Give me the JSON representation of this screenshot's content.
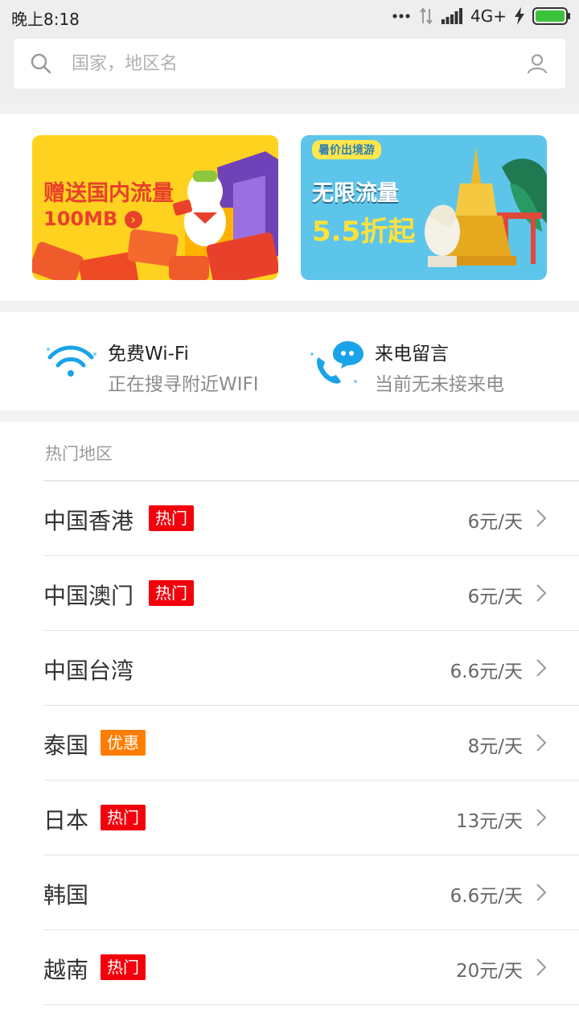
{
  "status_bar": {
    "time": "晚上8:18",
    "network": "4G+",
    "icons": [
      "dots-icon",
      "data-arrows-icon",
      "signal-icon",
      "charging-icon",
      "battery-icon"
    ]
  },
  "search": {
    "placeholder": "国家，地区名",
    "value": ""
  },
  "banners": [
    {
      "title": "赠送国内流量",
      "subtitle": "100MB"
    },
    {
      "tag": "暑价出境游",
      "title": "无限流量",
      "subtitle": "5.5折起"
    }
  ],
  "services": [
    {
      "title": "免费Wi-Fi",
      "subtitle": "正在搜寻附近WIFI",
      "icon": "wifi-icon"
    },
    {
      "title": "来电留言",
      "subtitle": "当前无未接来电",
      "icon": "voicemail-icon"
    }
  ],
  "hot_regions": {
    "title": "热门地区",
    "items": [
      {
        "name": "中国香港",
        "badge": "热门",
        "price": "6元/天"
      },
      {
        "name": "中国澳门",
        "badge": "热门",
        "price": "6元/天"
      },
      {
        "name": "中国台湾",
        "badge": "",
        "price": "6.6元/天"
      },
      {
        "name": "泰国",
        "badge": "优惠",
        "price": "8元/天"
      },
      {
        "name": "日本",
        "badge": "热门",
        "price": "13元/天"
      },
      {
        "name": "韩国",
        "badge": "",
        "price": "6.6元/天"
      },
      {
        "name": "越南",
        "badge": "热门",
        "price": "20元/天"
      }
    ]
  },
  "colors": {
    "hot_badge": "#f2000c",
    "discount_badge": "#ff7d00",
    "banner_yellow": "#ffd21f",
    "banner_blue": "#5ec5ea",
    "accent_blue": "#1aa3e8"
  }
}
